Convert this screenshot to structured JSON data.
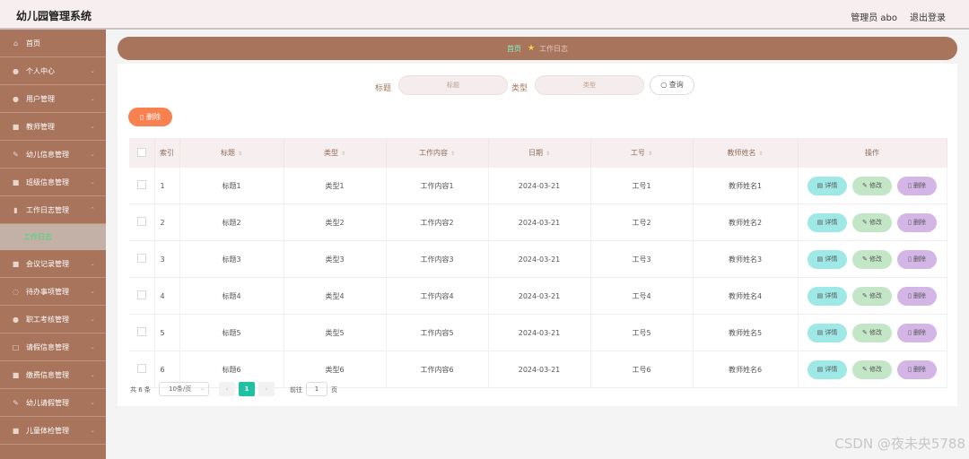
{
  "app_title": "幼儿园管理系统",
  "header": {
    "admin_label": "管理员 abo",
    "logout_label": "退出登录"
  },
  "sidebar": {
    "items": [
      {
        "label": "首页",
        "icon": "⌂"
      },
      {
        "label": "个人中心",
        "icon": "●"
      },
      {
        "label": "用户管理",
        "icon": "●"
      },
      {
        "label": "教师管理",
        "icon": "■"
      },
      {
        "label": "幼儿信息管理",
        "icon": "✎"
      },
      {
        "label": "班级信息管理",
        "icon": "■"
      },
      {
        "label": "工作日志管理",
        "icon": "▮"
      }
    ],
    "active_sub": "工作日志",
    "items_after": [
      {
        "label": "会议记录管理",
        "icon": "■"
      },
      {
        "label": "待办事项管理",
        "icon": "◌"
      },
      {
        "label": "职工考核管理",
        "icon": "●"
      },
      {
        "label": "请假信息管理",
        "icon": "□"
      },
      {
        "label": "缴费信息管理",
        "icon": "■"
      },
      {
        "label": "幼儿请假管理",
        "icon": "✎"
      },
      {
        "label": "儿童体检管理",
        "icon": "■"
      }
    ]
  },
  "breadcrumb": {
    "home": "首页",
    "current": "工作日志"
  },
  "search": {
    "title_label": "标题",
    "title_placeholder": "标题",
    "type_label": "类型",
    "type_placeholder": "类型",
    "query_label": "查询"
  },
  "toolbar": {
    "delete_label": "删除"
  },
  "table": {
    "headers": [
      "索引",
      "标题",
      "类型",
      "工作内容",
      "日期",
      "工号",
      "教师姓名",
      "操作"
    ],
    "rows": [
      [
        "1",
        "标题1",
        "类型1",
        "工作内容1",
        "2024-03-21",
        "工号1",
        "教师姓名1"
      ],
      [
        "2",
        "标题2",
        "类型2",
        "工作内容2",
        "2024-03-21",
        "工号2",
        "教师姓名2"
      ],
      [
        "3",
        "标题3",
        "类型3",
        "工作内容3",
        "2024-03-21",
        "工号3",
        "教师姓名3"
      ],
      [
        "4",
        "标题4",
        "类型4",
        "工作内容4",
        "2024-03-21",
        "工号4",
        "教师姓名4"
      ],
      [
        "5",
        "标题5",
        "类型5",
        "工作内容5",
        "2024-03-21",
        "工号5",
        "教师姓名5"
      ],
      [
        "6",
        "标题6",
        "类型6",
        "工作内容6",
        "2024-03-21",
        "工号6",
        "教师姓名6"
      ]
    ],
    "actions": {
      "detail": "详情",
      "edit": "修改",
      "delete": "删除"
    }
  },
  "pagination": {
    "total_text": "共 6 条",
    "page_size": "10条/页",
    "prev": "‹",
    "next": "›",
    "current_page": "1",
    "goto_label": "前往",
    "goto_value": "1",
    "page_word": "页"
  },
  "watermark": "CSDN @夜未央5788",
  "colors": {
    "sidebar": "#a8745c",
    "breadcrumb_bg": "#a8745c",
    "delete_button": "#f7814f",
    "detail_button": "#9ee8e5",
    "edit_button": "#c3e6c6",
    "remove_button": "#d3b5e6",
    "active_page": "#20c0a0"
  }
}
